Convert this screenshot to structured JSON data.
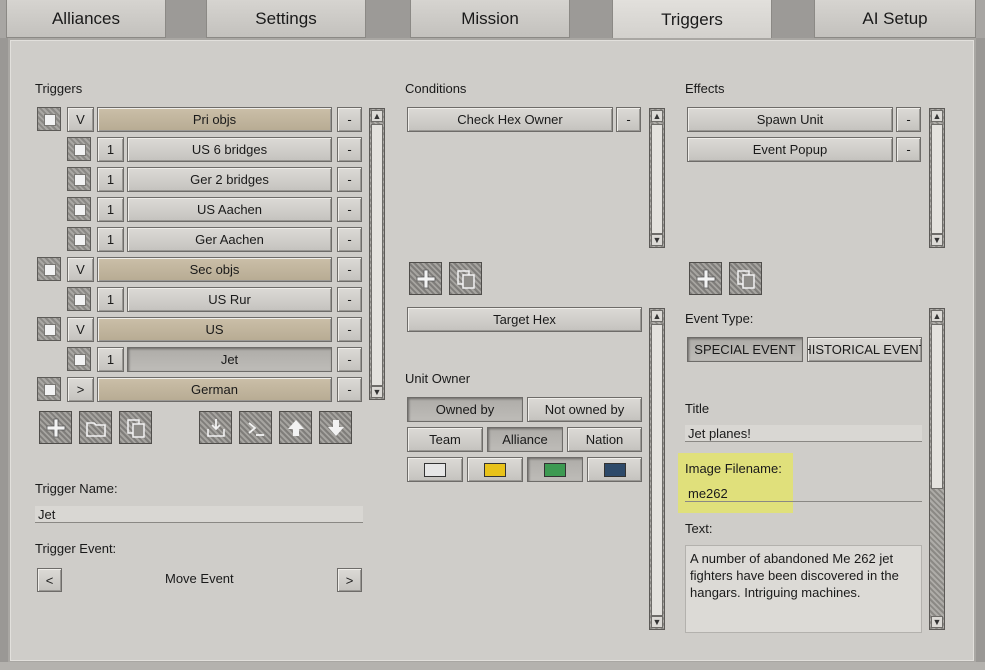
{
  "tabs": [
    "Alliances",
    "Settings",
    "Mission",
    "Triggers",
    "AI Setup"
  ],
  "active_tab": "Triggers",
  "triggers": {
    "heading": "Triggers",
    "rows": [
      {
        "toggle": "V",
        "name": "Pri objs",
        "remove": "-",
        "group": true
      },
      {
        "toggle": "1",
        "name": "US 6 bridges",
        "remove": "-",
        "group": false
      },
      {
        "toggle": "1",
        "name": "Ger 2 bridges",
        "remove": "-",
        "group": false
      },
      {
        "toggle": "1",
        "name": "US Aachen",
        "remove": "-",
        "group": false
      },
      {
        "toggle": "1",
        "name": "Ger Aachen",
        "remove": "-",
        "group": false
      },
      {
        "toggle": "V",
        "name": "Sec objs",
        "remove": "-",
        "group": true
      },
      {
        "toggle": "1",
        "name": "US Rur",
        "remove": "-",
        "group": false
      },
      {
        "toggle": "V",
        "name": "US",
        "remove": "-",
        "group": true
      },
      {
        "toggle": "1",
        "name": "Jet",
        "remove": "-",
        "group": false
      },
      {
        "toggle": ">",
        "name": "German",
        "remove": "-",
        "group": true
      }
    ],
    "name_label": "Trigger Name:",
    "name_value": "Jet",
    "event_label": "Trigger Event:",
    "event_prev": "<",
    "event_value": "Move Event",
    "event_next": ">"
  },
  "conditions": {
    "heading": "Conditions",
    "items": [
      {
        "label": "Check Hex Owner",
        "remove": "-"
      }
    ],
    "target_hex": "Target Hex",
    "unit_owner_label": "Unit Owner",
    "owned_by": "Owned by",
    "not_owned_by": "Not owned by",
    "team": "Team",
    "alliance": "Alliance",
    "nation": "Nation",
    "swatch_colors": [
      "#e6e6e6",
      "#e8c21a",
      "#3d9a52",
      "#2e4a6a"
    ]
  },
  "effects": {
    "heading": "Effects",
    "items": [
      {
        "label": "Spawn Unit",
        "remove": "-"
      },
      {
        "label": "Event Popup",
        "remove": "-"
      }
    ],
    "event_type_label": "Event Type:",
    "special_event": "SPECIAL EVENT",
    "historical_event": "HISTORICAL EVENT",
    "title_label": "Title",
    "title_value": "Jet planes!",
    "image_label": "Image Filename:",
    "image_value": "me262",
    "text_label": "Text:",
    "text_value": "A number of abandoned Me 262 jet fighters have been discovered in the hangars. Intriguing machines."
  },
  "colors": {
    "tan": "#c2b69e",
    "highlight": "#eef03a"
  }
}
